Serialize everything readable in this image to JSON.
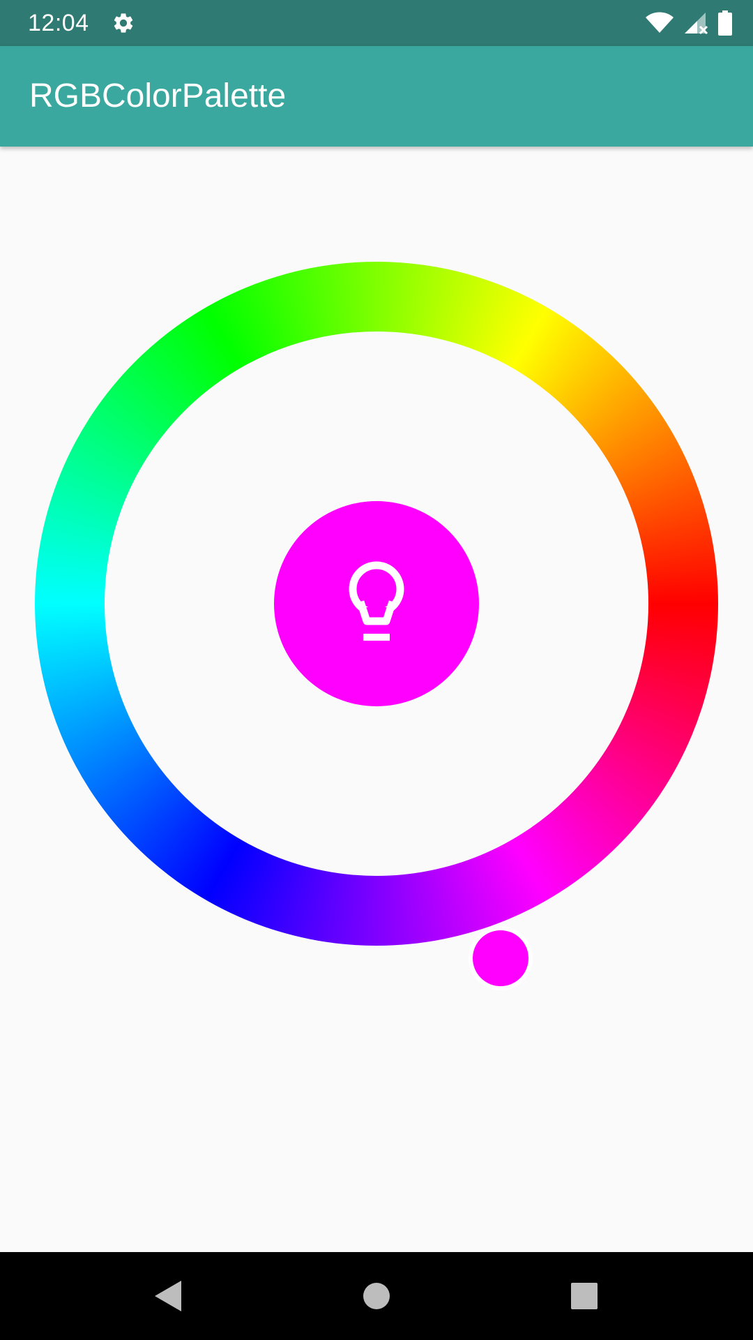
{
  "status_bar": {
    "time": "12:04",
    "icons": [
      "settings-icon",
      "wifi-icon",
      "cellular-signal-icon",
      "battery-icon"
    ]
  },
  "app_bar": {
    "title": "RGBColorPalette"
  },
  "color_wheel": {
    "selected_color": "#FF00FF",
    "ring_colors": [
      "#FF0000",
      "#FF00FF",
      "#0000FF",
      "#00FFFF",
      "#00FF00",
      "#FFFF00"
    ],
    "center_icon": "lightbulb-icon"
  },
  "nav_bar": {
    "buttons": [
      "back-icon",
      "home-icon",
      "recents-icon"
    ]
  },
  "colors": {
    "status_bar": "#2F7A73",
    "app_bar": "#3AA89E",
    "background": "#FAFAFA"
  }
}
